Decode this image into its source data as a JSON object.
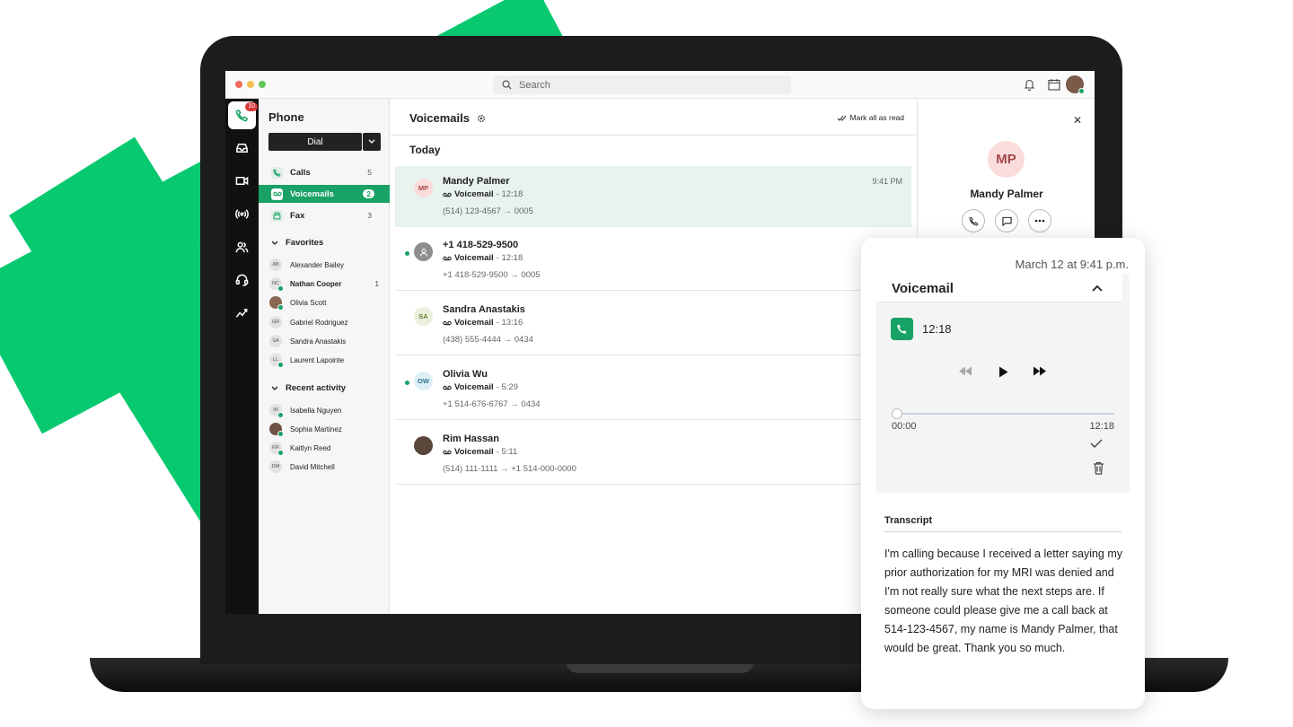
{
  "colors": {
    "brand_green": "#08c96f",
    "accent": "#18a266",
    "badge_red": "#d83a3a"
  },
  "topbar": {
    "search_placeholder": "Search",
    "icons": [
      "search-icon",
      "bell-icon",
      "calendar-icon",
      "avatar"
    ]
  },
  "rail": {
    "items": [
      "phone-icon",
      "inbox-icon",
      "video-icon",
      "broadcast-icon",
      "contacts-icon",
      "headset-icon",
      "analytics-icon"
    ],
    "phone_badge": "10"
  },
  "sidebar": {
    "title": "Phone",
    "dial_label": "Dial",
    "nav": [
      {
        "label": "Calls",
        "count": "5"
      },
      {
        "label": "Voicemails",
        "count": "2"
      },
      {
        "label": "Fax",
        "count": "3"
      }
    ],
    "favorites_label": "Favorites",
    "favorites": [
      {
        "initials": "AB",
        "name": "Alexander Bailey",
        "count": ""
      },
      {
        "initials": "NC",
        "name": "Nathan Cooper",
        "count": "1"
      },
      {
        "initials": "",
        "name": "Olivia Scott",
        "count": ""
      },
      {
        "initials": "GR",
        "name": "Gabriel Rodriguez",
        "count": ""
      },
      {
        "initials": "SA",
        "name": "Sandra Anastakis",
        "count": ""
      },
      {
        "initials": "LL",
        "name": "Laurent Lapointe",
        "count": ""
      }
    ],
    "recent_label": "Recent activity",
    "recent": [
      {
        "initials": "IN",
        "name": "Isabella Nguyen"
      },
      {
        "initials": "",
        "name": "Sophia Martinez"
      },
      {
        "initials": "KR",
        "name": "Kaitlyn Reed"
      },
      {
        "initials": "DM",
        "name": "David Mitchell"
      }
    ]
  },
  "main": {
    "title": "Voicemails",
    "mark_all_read": "Mark all as read",
    "section": "Today",
    "voicemails": [
      {
        "initials": "MP",
        "name": "Mandy Palmer",
        "type": "Voicemail",
        "duration": " - 12:18",
        "route": "(514) 123-4567  →  0005",
        "time": "9:41 PM"
      },
      {
        "initials": "",
        "name": "+1 418-529-9500",
        "type": "Voicemail",
        "duration": " - 12:18",
        "route": "+1 418-529-9500  →  0005",
        "time": ""
      },
      {
        "initials": "SA",
        "name": "Sandra Anastakis",
        "type": "Voicemail",
        "duration": " - 13:16",
        "route": "(438) 555-4444  →  0434",
        "time": ""
      },
      {
        "initials": "OW",
        "name": "Olivia Wu",
        "type": "Voicemail",
        "duration": " - 5:29",
        "route": "+1 514-676-6767  →  0434",
        "time": ""
      },
      {
        "initials": "",
        "name": "Rim Hassan",
        "type": "Voicemail",
        "duration": " - 5:11",
        "route": "(514) 111-1111  →  +1 514-000-0000",
        "time": ""
      }
    ]
  },
  "detail": {
    "initials": "MP",
    "name": "Mandy Palmer"
  },
  "card": {
    "date": "March 12 at 9:41 p.m.",
    "section_title": "Voicemail",
    "length": "12:18",
    "progress": 0.0,
    "time_start": "00:00",
    "time_end": "12:18",
    "transcript_label": "Transcript",
    "transcript": "I'm calling because I received a letter saying my prior authorization for my MRI was denied and I'm not really sure what the next steps are. If someone could please give me a call back at 514-123-4567, my name is Mandy Palmer, that would be great. Thank you so much."
  }
}
